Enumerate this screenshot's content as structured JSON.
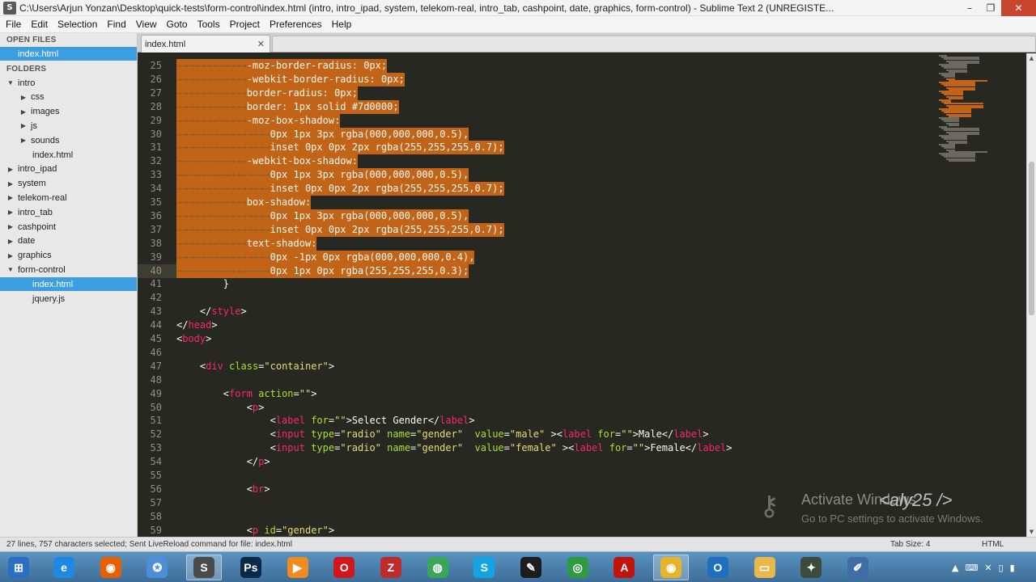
{
  "window": {
    "title": "C:\\Users\\Arjun Yonzan\\Desktop\\quick-tests\\form-control\\index.html (intro, intro_ipad, system, telekom-real, intro_tab, cashpoint, date, graphics, form-control) - Sublime Text 2 (UNREGISTE...",
    "app_icon": "S",
    "controls": {
      "minimize": "–",
      "maximize": "❐",
      "close": "✕"
    }
  },
  "menu": [
    "File",
    "Edit",
    "Selection",
    "Find",
    "View",
    "Goto",
    "Tools",
    "Project",
    "Preferences",
    "Help"
  ],
  "sidebar": {
    "open_files_header": "OPEN FILES",
    "open_files": [
      {
        "label": "index.html",
        "selected": true
      }
    ],
    "folders_header": "FOLDERS",
    "tree": [
      {
        "label": "intro",
        "indent": 0,
        "expanded": true,
        "type": "folder"
      },
      {
        "label": "css",
        "indent": 1,
        "expanded": false,
        "type": "folder"
      },
      {
        "label": "images",
        "indent": 1,
        "expanded": false,
        "type": "folder"
      },
      {
        "label": "js",
        "indent": 1,
        "expanded": false,
        "type": "folder"
      },
      {
        "label": "sounds",
        "indent": 1,
        "expanded": false,
        "type": "folder"
      },
      {
        "label": "index.html",
        "indent": 1,
        "type": "file"
      },
      {
        "label": "intro_ipad",
        "indent": 0,
        "expanded": false,
        "type": "folder"
      },
      {
        "label": "system",
        "indent": 0,
        "expanded": false,
        "type": "folder"
      },
      {
        "label": "telekom-real",
        "indent": 0,
        "expanded": false,
        "type": "folder"
      },
      {
        "label": "intro_tab",
        "indent": 0,
        "expanded": false,
        "type": "folder"
      },
      {
        "label": "cashpoint",
        "indent": 0,
        "expanded": false,
        "type": "folder"
      },
      {
        "label": "date",
        "indent": 0,
        "expanded": false,
        "type": "folder"
      },
      {
        "label": "graphics",
        "indent": 0,
        "expanded": false,
        "type": "folder"
      },
      {
        "label": "form-control",
        "indent": 0,
        "expanded": true,
        "type": "folder"
      },
      {
        "label": "index.html",
        "indent": 1,
        "type": "file",
        "selected": true
      },
      {
        "label": "jquery.js",
        "indent": 1,
        "type": "file"
      }
    ]
  },
  "tabs": {
    "active": "index.html",
    "close_icon": "✕"
  },
  "editor": {
    "lines": [
      {
        "n": 25,
        "sel": true,
        "segs": [
          [
            "ws",
            "→→→→→→→→→→→→"
          ],
          [
            "pl",
            "-moz-border-radius: 0px;"
          ]
        ]
      },
      {
        "n": 26,
        "sel": true,
        "segs": [
          [
            "ws",
            "→→→→→→→→→→→→"
          ],
          [
            "pl",
            "-webkit-border-radius: 0px;"
          ]
        ]
      },
      {
        "n": 27,
        "sel": true,
        "segs": [
          [
            "ws",
            "→→→→→→→→→→→→"
          ],
          [
            "pl",
            "border-radius: 0px;"
          ]
        ]
      },
      {
        "n": 28,
        "sel": true,
        "segs": [
          [
            "ws",
            "→→→→→→→→→→→→"
          ],
          [
            "pl",
            "border: 1px solid #7d0000;"
          ]
        ]
      },
      {
        "n": 29,
        "sel": true,
        "segs": [
          [
            "ws",
            "→→→→→→→→→→→→"
          ],
          [
            "pl",
            "-moz-box-shadow:"
          ]
        ]
      },
      {
        "n": 30,
        "sel": true,
        "segs": [
          [
            "ws",
            "→→→→→→→→→→→→→→→→"
          ],
          [
            "pl",
            "0px 1px 3px rgba(000,000,000,0.5),"
          ]
        ]
      },
      {
        "n": 31,
        "sel": true,
        "segs": [
          [
            "ws",
            "→→→→→→→→→→→→→→→→"
          ],
          [
            "pl",
            "inset 0px 0px 2px rgba(255,255,255,0.7);"
          ]
        ]
      },
      {
        "n": 32,
        "sel": true,
        "segs": [
          [
            "ws",
            "→→→→→→→→→→→→"
          ],
          [
            "pl",
            "-webkit-box-shadow:"
          ]
        ]
      },
      {
        "n": 33,
        "sel": true,
        "segs": [
          [
            "ws",
            "→→→→→→→→→→→→→→→→"
          ],
          [
            "pl",
            "0px 1px 3px rgba(000,000,000,0.5),"
          ]
        ]
      },
      {
        "n": 34,
        "sel": true,
        "segs": [
          [
            "ws",
            "→→→→→→→→→→→→→→→→"
          ],
          [
            "pl",
            "inset 0px 0px 2px rgba(255,255,255,0.7);"
          ]
        ]
      },
      {
        "n": 35,
        "sel": true,
        "segs": [
          [
            "ws",
            "→→→→→→→→→→→→"
          ],
          [
            "pl",
            "box-shadow:"
          ]
        ]
      },
      {
        "n": 36,
        "sel": true,
        "segs": [
          [
            "ws",
            "→→→→→→→→→→→→→→→→"
          ],
          [
            "pl",
            "0px 1px 3px rgba(000,000,000,0.5),"
          ]
        ]
      },
      {
        "n": 37,
        "sel": true,
        "segs": [
          [
            "ws",
            "→→→→→→→→→→→→→→→→"
          ],
          [
            "pl",
            "inset 0px 0px 2px rgba(255,255,255,0.7);"
          ]
        ]
      },
      {
        "n": 38,
        "sel": true,
        "segs": [
          [
            "ws",
            "→→→→→→→→→→→→"
          ],
          [
            "pl",
            "text-shadow:"
          ]
        ]
      },
      {
        "n": 39,
        "sel": true,
        "segs": [
          [
            "ws",
            "→→→→→→→→→→→→→→→→"
          ],
          [
            "pl",
            "0px -1px 0px rgba(000,000,000,0.4),"
          ]
        ]
      },
      {
        "n": 40,
        "sel": true,
        "caret": true,
        "segs": [
          [
            "ws",
            "→→→→→→→→→→→→→→→→"
          ],
          [
            "pl",
            "0px 1px 0px rgba(255,255,255,0.3);"
          ]
        ]
      },
      {
        "n": 41,
        "segs": [
          [
            "pl",
            "        }"
          ]
        ]
      },
      {
        "n": 42,
        "segs": []
      },
      {
        "n": 43,
        "segs": [
          [
            "pl",
            "    </"
          ],
          [
            "tg",
            "style"
          ],
          [
            "pl",
            ">"
          ]
        ]
      },
      {
        "n": 44,
        "segs": [
          [
            "pl",
            "</"
          ],
          [
            "tg",
            "head"
          ],
          [
            "pl",
            ">"
          ]
        ]
      },
      {
        "n": 45,
        "segs": [
          [
            "pl",
            "<"
          ],
          [
            "tg",
            "body"
          ],
          [
            "pl",
            ">"
          ]
        ]
      },
      {
        "n": 46,
        "segs": []
      },
      {
        "n": 47,
        "segs": [
          [
            "pl",
            "    <"
          ],
          [
            "tg",
            "div"
          ],
          [
            "pl",
            " "
          ],
          [
            "at",
            "class"
          ],
          [
            "pl",
            "="
          ],
          [
            "st",
            "\"container\""
          ],
          [
            "pl",
            ">"
          ]
        ]
      },
      {
        "n": 48,
        "segs": []
      },
      {
        "n": 49,
        "segs": [
          [
            "pl",
            "        <"
          ],
          [
            "tg",
            "form"
          ],
          [
            "pl",
            " "
          ],
          [
            "at",
            "action"
          ],
          [
            "pl",
            "="
          ],
          [
            "st",
            "\"\""
          ],
          [
            "pl",
            ">"
          ]
        ]
      },
      {
        "n": 50,
        "segs": [
          [
            "pl",
            "            <"
          ],
          [
            "tg",
            "p"
          ],
          [
            "pl",
            ">"
          ]
        ]
      },
      {
        "n": 51,
        "segs": [
          [
            "pl",
            "                <"
          ],
          [
            "tg",
            "label"
          ],
          [
            "pl",
            " "
          ],
          [
            "at",
            "for"
          ],
          [
            "pl",
            "="
          ],
          [
            "st",
            "\"\""
          ],
          [
            "pl",
            ">Select Gender</"
          ],
          [
            "tg",
            "label"
          ],
          [
            "pl",
            ">"
          ]
        ]
      },
      {
        "n": 52,
        "segs": [
          [
            "pl",
            "                <"
          ],
          [
            "tg",
            "input"
          ],
          [
            "pl",
            " "
          ],
          [
            "at",
            "type"
          ],
          [
            "pl",
            "="
          ],
          [
            "st",
            "\"radio\""
          ],
          [
            "pl",
            " "
          ],
          [
            "at",
            "name"
          ],
          [
            "pl",
            "="
          ],
          [
            "st",
            "\"gender\""
          ],
          [
            "pl",
            "  "
          ],
          [
            "at",
            "value"
          ],
          [
            "pl",
            "="
          ],
          [
            "st",
            "\"male\""
          ],
          [
            "pl",
            " ><"
          ],
          [
            "tg",
            "label"
          ],
          [
            "pl",
            " "
          ],
          [
            "at",
            "for"
          ],
          [
            "pl",
            "="
          ],
          [
            "st",
            "\"\""
          ],
          [
            "pl",
            ">Male</"
          ],
          [
            "tg",
            "label"
          ],
          [
            "pl",
            ">"
          ]
        ]
      },
      {
        "n": 53,
        "segs": [
          [
            "pl",
            "                <"
          ],
          [
            "tg",
            "input"
          ],
          [
            "pl",
            " "
          ],
          [
            "at",
            "type"
          ],
          [
            "pl",
            "="
          ],
          [
            "st",
            "\"radio\""
          ],
          [
            "pl",
            " "
          ],
          [
            "at",
            "name"
          ],
          [
            "pl",
            "="
          ],
          [
            "st",
            "\"gender\""
          ],
          [
            "pl",
            "  "
          ],
          [
            "at",
            "value"
          ],
          [
            "pl",
            "="
          ],
          [
            "st",
            "\"female\""
          ],
          [
            "pl",
            " ><"
          ],
          [
            "tg",
            "label"
          ],
          [
            "pl",
            " "
          ],
          [
            "at",
            "for"
          ],
          [
            "pl",
            "="
          ],
          [
            "st",
            "\"\""
          ],
          [
            "pl",
            ">Female</"
          ],
          [
            "tg",
            "label"
          ],
          [
            "pl",
            ">"
          ]
        ]
      },
      {
        "n": 54,
        "segs": [
          [
            "pl",
            "            </"
          ],
          [
            "tg",
            "p"
          ],
          [
            "pl",
            ">"
          ]
        ]
      },
      {
        "n": 55,
        "segs": []
      },
      {
        "n": 56,
        "segs": [
          [
            "pl",
            "            <"
          ],
          [
            "tg",
            "br"
          ],
          [
            "pl",
            ">"
          ]
        ]
      },
      {
        "n": 57,
        "segs": []
      },
      {
        "n": 58,
        "segs": []
      },
      {
        "n": 59,
        "segs": [
          [
            "pl",
            "            <"
          ],
          [
            "tg",
            "p"
          ],
          [
            "pl",
            " "
          ],
          [
            "at",
            "id"
          ],
          [
            "pl",
            "="
          ],
          [
            "st",
            "\"gender\""
          ],
          [
            "pl",
            ">"
          ]
        ]
      }
    ]
  },
  "watermark": {
    "title": "Activate Windows",
    "subtitle": "Go to PC settings to activate Windows.",
    "brand": "<aly25 />"
  },
  "status": {
    "left": "27 lines, 757 characters selected; Sent LiveReload command for file: index.html",
    "tab_size": "Tab Size: 4",
    "syntax": "HTML"
  },
  "taskbar": {
    "icons": [
      {
        "name": "windows-start-icon",
        "glyph": "⊞",
        "color": "#2a6fc4"
      },
      {
        "name": "internet-explorer-icon",
        "glyph": "e",
        "color": "#1e88e5"
      },
      {
        "name": "firefox-icon",
        "glyph": "◉",
        "color": "#e66000"
      },
      {
        "name": "safari-icon",
        "glyph": "✪",
        "color": "#4c8fd6"
      },
      {
        "name": "sublime-text-icon",
        "glyph": "S",
        "color": "#4a4a4a",
        "active": true
      },
      {
        "name": "photoshop-icon",
        "glyph": "Ps",
        "color": "#0b2a4a"
      },
      {
        "name": "media-player-icon",
        "glyph": "▶",
        "color": "#f08c1e"
      },
      {
        "name": "opera-icon",
        "glyph": "O",
        "color": "#d1161d"
      },
      {
        "name": "filezilla-icon",
        "glyph": "Z",
        "color": "#bf2b2b"
      },
      {
        "name": "chrome-canary-icon",
        "glyph": "◍",
        "color": "#3aa657"
      },
      {
        "name": "skype-icon",
        "glyph": "S",
        "color": "#12a5e3"
      },
      {
        "name": "tool-icon",
        "glyph": "✎",
        "color": "#1d1d1d"
      },
      {
        "name": "network-globe-icon",
        "glyph": "◎",
        "color": "#2e9b3f"
      },
      {
        "name": "acrobat-icon",
        "glyph": "A",
        "color": "#c3140c"
      },
      {
        "name": "chrome-icon",
        "glyph": "◉",
        "color": "#e4b52b",
        "active": true
      },
      {
        "name": "outlook-icon",
        "glyph": "O",
        "color": "#1f6fbf"
      },
      {
        "name": "file-explorer-icon",
        "glyph": "▭",
        "color": "#e8b84a"
      },
      {
        "name": "settings-tool-icon",
        "glyph": "✦",
        "color": "#3d4b3d"
      },
      {
        "name": "paint-icon",
        "glyph": "✐",
        "color": "#3f6ea6"
      }
    ],
    "tray": [
      "▲",
      "⌨",
      "✕",
      "▯",
      "▮"
    ]
  }
}
